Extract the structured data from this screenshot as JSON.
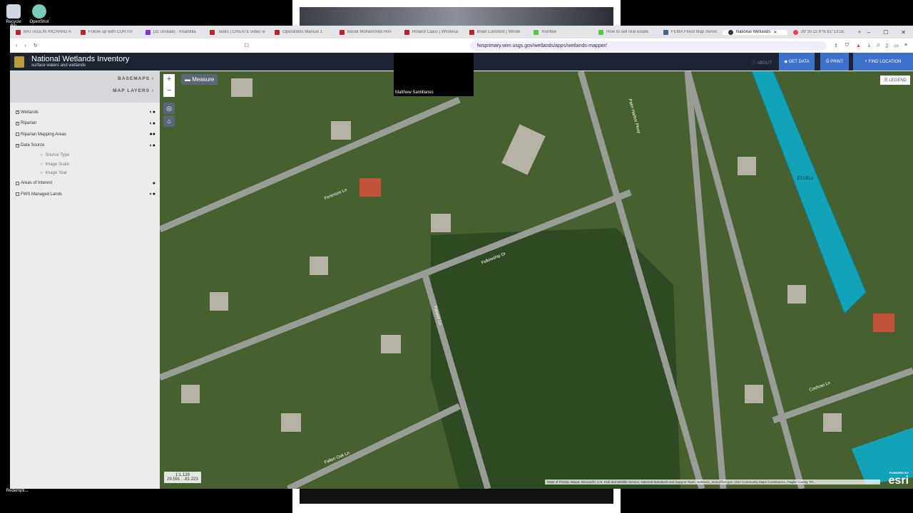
{
  "desktop": {
    "icons": [
      "Recycle Bin",
      "OpenShot"
    ],
    "bottom_label": "Redempti..."
  },
  "tabs": [
    {
      "label": "BATTAGLIN RICHARD A"
    },
    {
      "label": "Follow up with CURTIS"
    },
    {
      "label": "(32 unread) - msantilla"
    },
    {
      "label": "Tasks | CREATE video w"
    },
    {
      "label": "Operations Manual 1"
    },
    {
      "label": "Barak Mohammed Hon"
    },
    {
      "label": "Roland Caasi | Wholesa"
    },
    {
      "label": "Brian Lunsford | Whole"
    },
    {
      "label": "Rumble"
    },
    {
      "label": "How to sell real estate"
    },
    {
      "label": "FEMA Flood Map Servic"
    },
    {
      "label": "National Wetlands"
    },
    {
      "label": "29°35'22.6\"N 81°13'16."
    }
  ],
  "url": "fwsprimary.wim.usgs.gov/wetlands/apps/wetlands-mapper/",
  "app": {
    "title": "National Wetlands Inventory",
    "subtitle": "surface waters and wetlands",
    "about": "ABOUT",
    "get_data": "GET DATA",
    "print": "PRINT",
    "find_location": "FIND LOCATION"
  },
  "presenter": "Matthew Santillanes",
  "sidebar": {
    "basemaps": "BASEMAPS",
    "map_layers": "MAP LAYERS",
    "layers": [
      {
        "label": "Wetlands",
        "checked": true
      },
      {
        "label": "Riparian",
        "checked": true
      },
      {
        "label": "Riparian Mapping Areas",
        "checked": false
      },
      {
        "label": "Data Source",
        "checked": true
      }
    ],
    "data_source_options": [
      "Source Type",
      "Image Scale",
      "Image Year"
    ],
    "layers2": [
      {
        "label": "Areas of Interest",
        "checked": false
      },
      {
        "label": "FWS Managed Lands",
        "checked": false
      }
    ]
  },
  "map": {
    "measure": "Measure",
    "legend": "LEGEND",
    "wetland_label": "E1UBLx",
    "scale": "1:1,128",
    "coords": "29.591 , -81.223",
    "attribution": "State of Florida, Maxar, Microsoft | U.S. Fish and Wildlife Service, National Standards and Support Team, wetlands_team@fws.gov | Esri Community Maps Contributors, Flagler County, FD...",
    "esri": "esri",
    "powered_by": "POWERED BY",
    "streets": [
      "Fenimore Ln",
      "Fellowship Dr",
      "Palm Harbor Pkwy",
      "Fallen Oak Ln",
      "Cochran Ln",
      "Farwell Ln"
    ],
    "wetland_color": "#13a3b8"
  }
}
